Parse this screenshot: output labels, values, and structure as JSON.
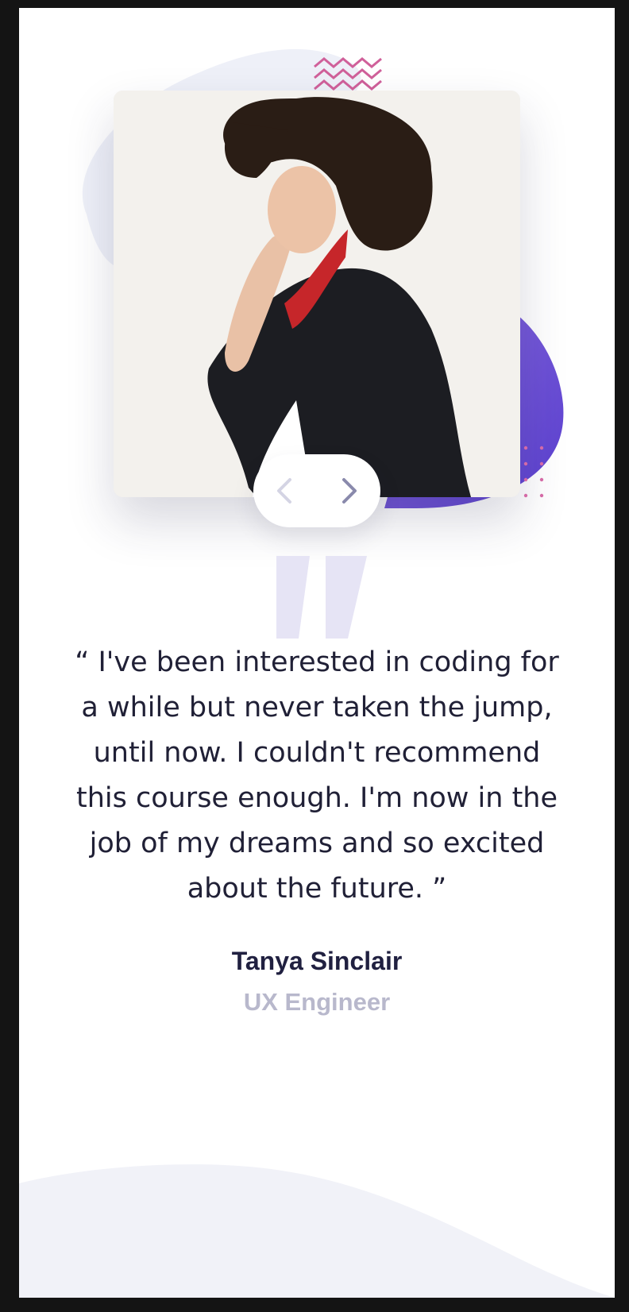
{
  "testimonial": {
    "quote": "“ I've been interested in coding for a while but never taken the jump, until now. I couldn't recommend this course enough. I'm now in the job of my dreams and so excited about the future. ”",
    "name": "Tanya Sinclair",
    "role": "UX Engineer"
  },
  "navigation": {
    "prev_icon": "chevron-left-icon",
    "next_icon": "chevron-right-icon",
    "prev_enabled": false,
    "next_enabled": true
  },
  "colors": {
    "page_background": "#141414",
    "card_background": "#ffffff",
    "accent_purple": "#6b4fd6",
    "dark_navy": "#202040",
    "muted_gray": "#b8b8cc",
    "quote_mark": "#e6e4f5",
    "blob_light": "#eef0f8",
    "zigzag_pink": "#d0609a"
  }
}
